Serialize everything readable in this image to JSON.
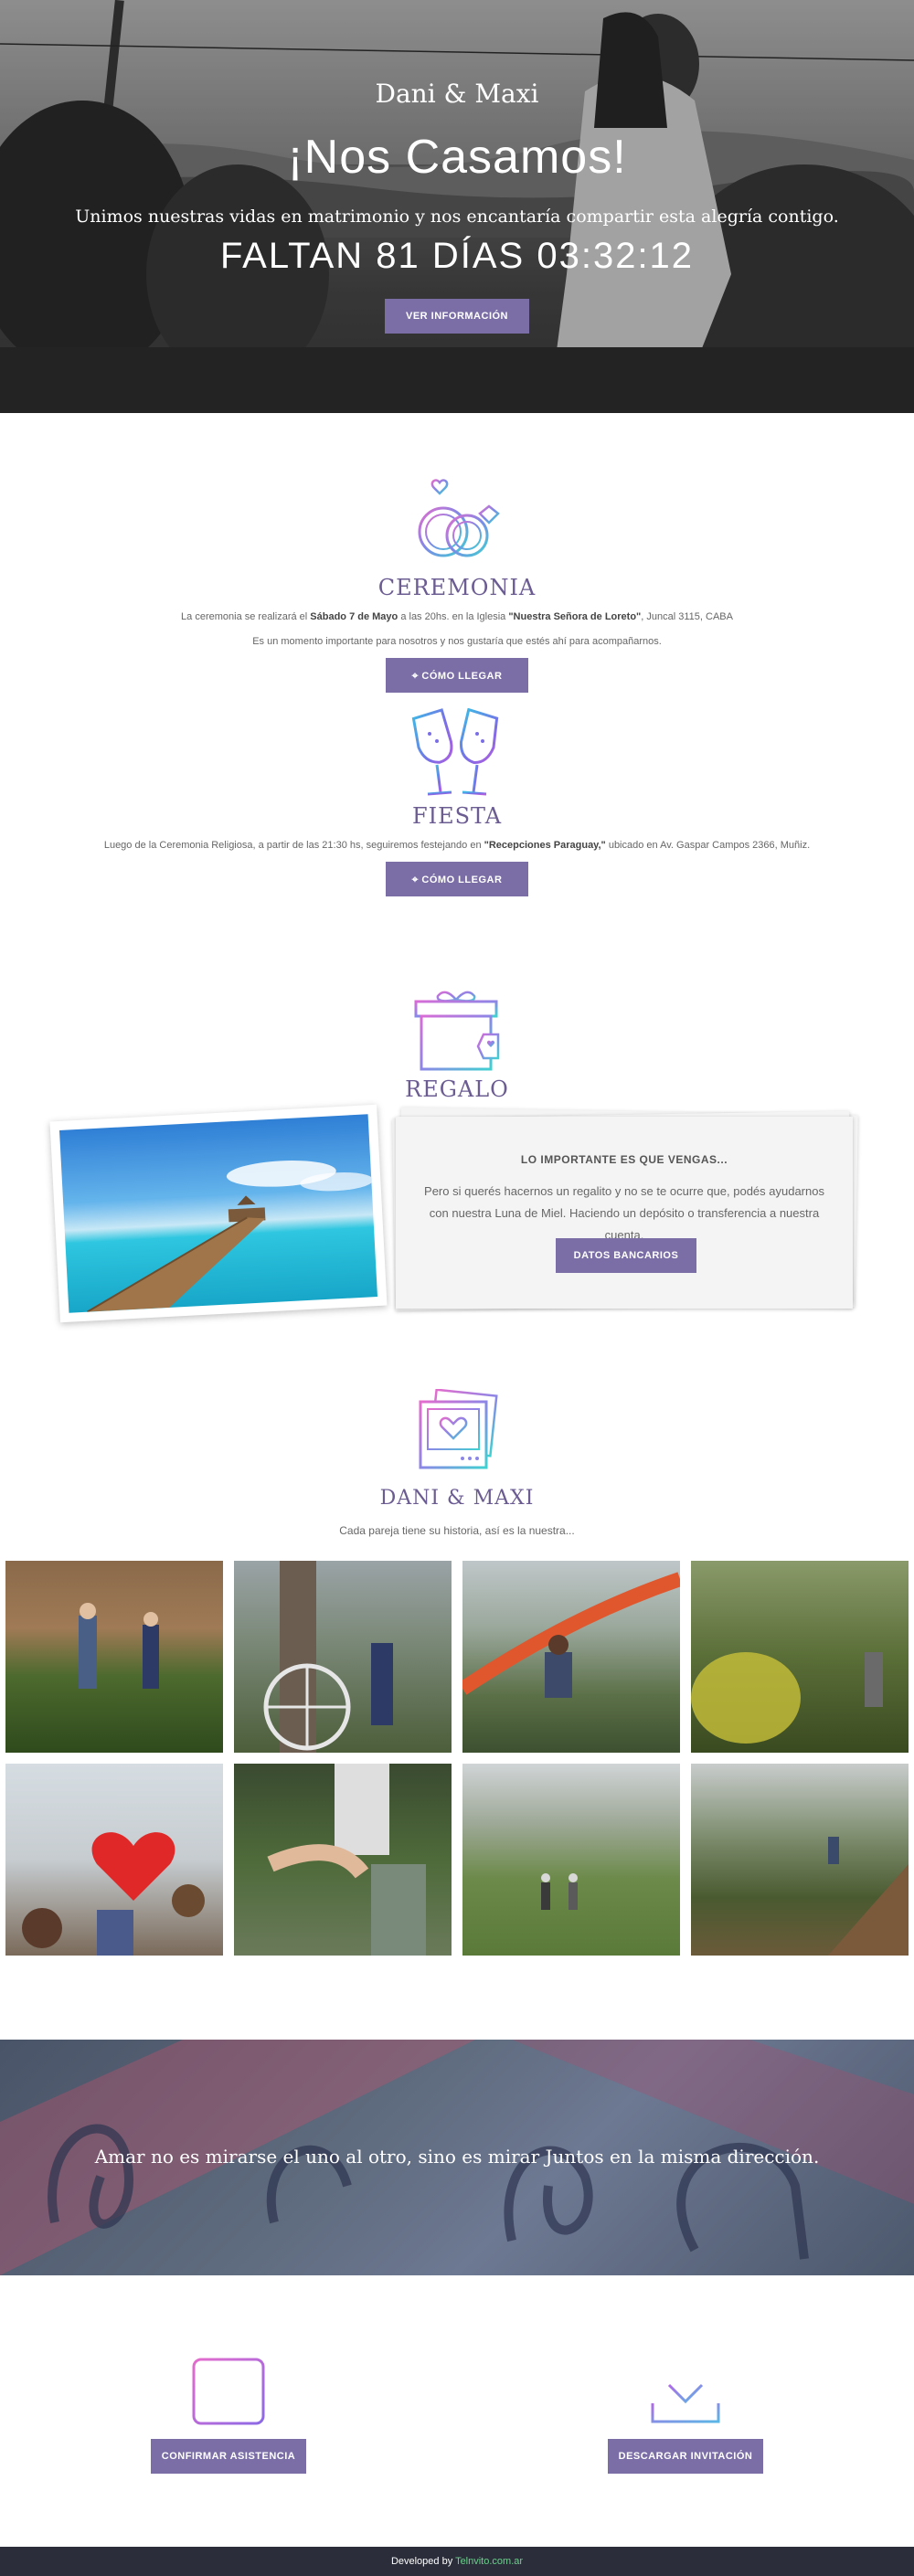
{
  "hero": {
    "names": "Dani & Maxi",
    "title": "¡Nos Casamos!",
    "subtitle": "Unimos nuestras vidas en matrimonio y nos encantaría compartir esta alegría contigo.",
    "countdown": "FALTAN 81 DÍAS 03:32:12",
    "button": "VER INFORMACIÓN"
  },
  "ceremonia": {
    "title": "CEREMONIA",
    "line1_a": "La ceremonia se realizará el ",
    "line1_b": "Sábado 7 de Mayo",
    "line1_c": " a las 20hs. en la Iglesia ",
    "line1_d": "\"Nuestra Señora de Loreto\"",
    "line1_e": ", Juncal 3115, CABA",
    "line2": "Es un momento importante para nosotros y nos gustaría que estés ahí para acompañarnos.",
    "button": "CÓMO LLEGAR",
    "icon": "rings-icon"
  },
  "fiesta": {
    "title": "FIESTA",
    "line1_a": "Luego de la Ceremonia Religiosa, a partir de las 21:30 hs, seguiremos festejando en ",
    "line1_b": "\"Recepciones Paraguay,\"",
    "line1_c": " ubicado en Av. Gaspar Campos 2366, Muñiz.",
    "button": "CÓMO LLEGAR",
    "icon": "champagne-icon"
  },
  "regalo": {
    "title": "REGALO",
    "heading": "LO IMPORTANTE ES QUE VENGAS...",
    "text": "Pero si querés hacernos un regalito y no se te ocurre que, podés ayudarnos con nuestra Luna de Miel. Haciendo un depósito o transferencia a nuestra cuenta.",
    "button": "DATOS BANCARIOS",
    "icon": "gift-icon"
  },
  "couple": {
    "title": "DANI & MAXI",
    "subtitle": "Cada pareja tiene su historia, así es la nuestra...",
    "icon": "photos-icon"
  },
  "quote": {
    "text": "Amar no es mirarse el uno al otro, sino es mirar Juntos en la misma dirección."
  },
  "actions": {
    "confirm": "CONFIRMAR ASISTENCIA",
    "download": "DESCARGAR INVITACIÓN"
  },
  "footer": {
    "prefix": "Developed by ",
    "site": "Telnvito.com.ar"
  },
  "colors": {
    "accent": "#7b6ea6",
    "title": "#6b5c92",
    "footer": "#2b2e3a"
  }
}
